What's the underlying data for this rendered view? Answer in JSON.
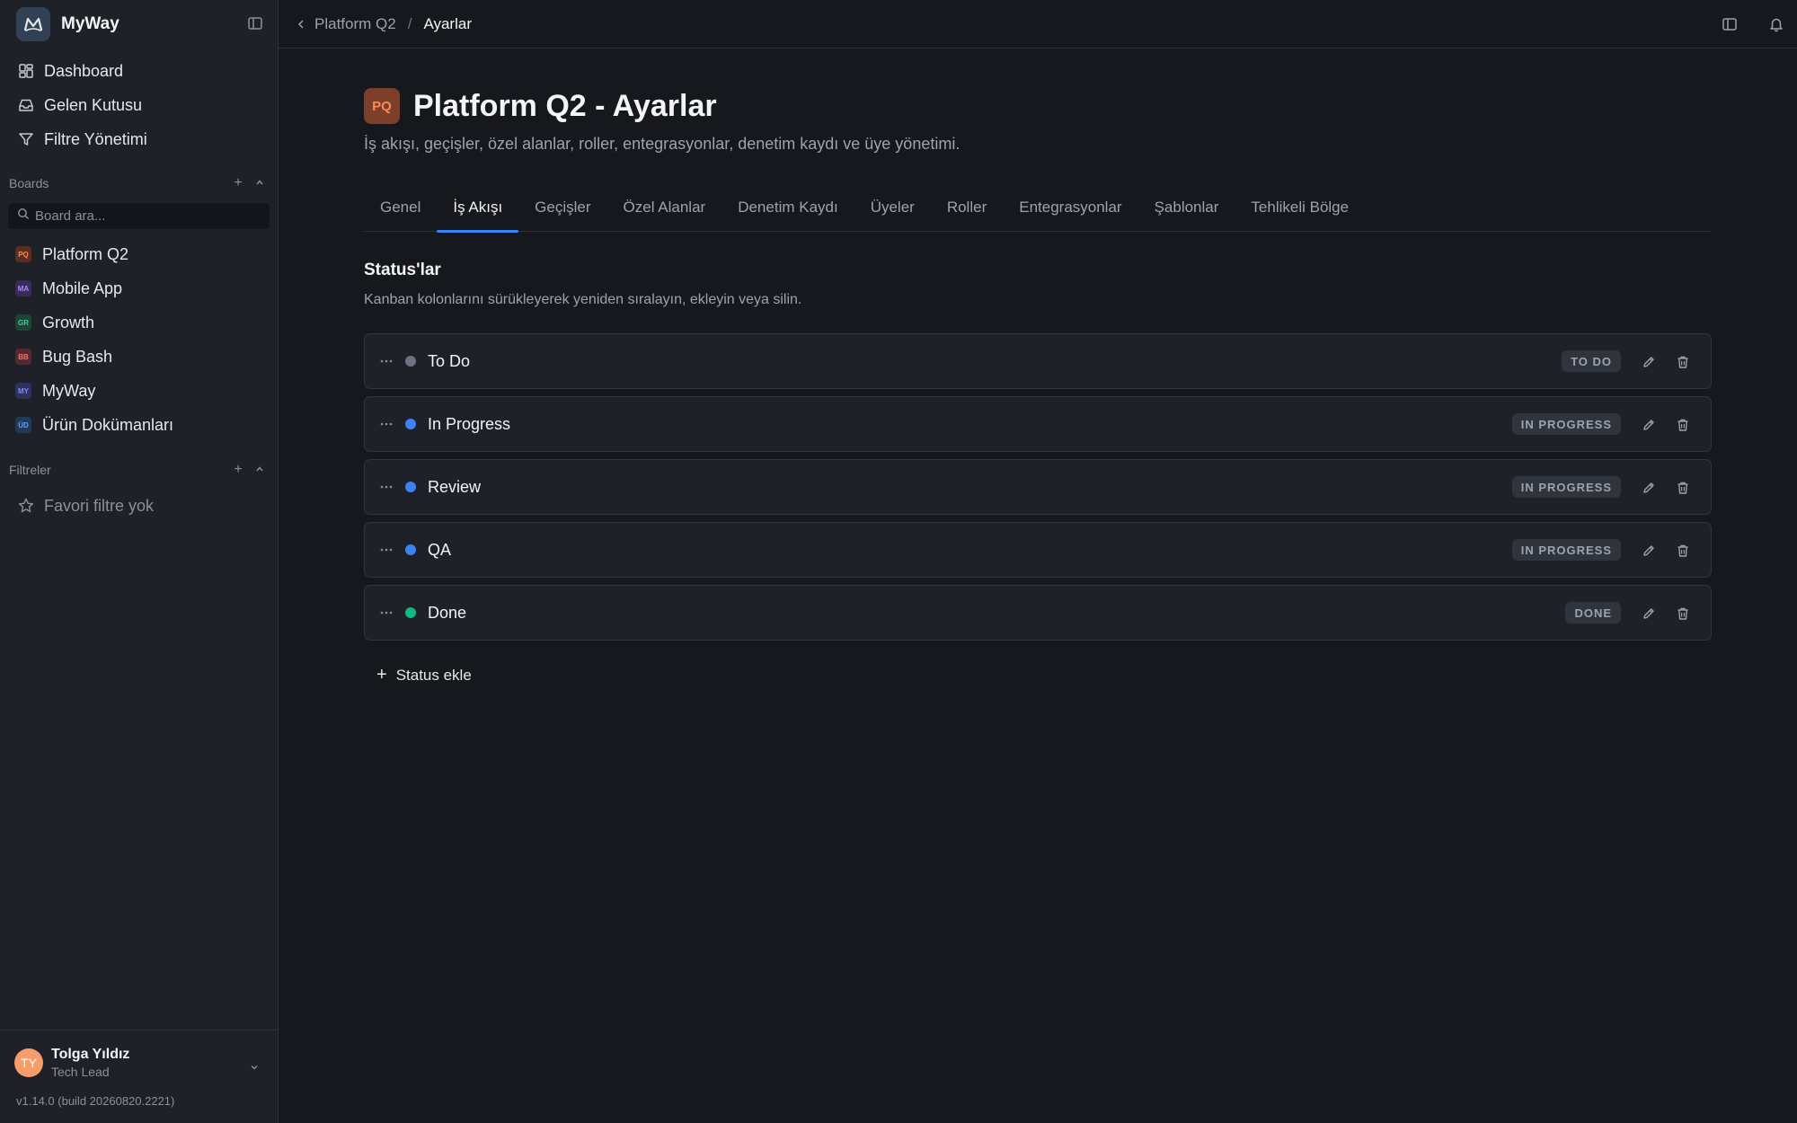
{
  "sidebar": {
    "brand": "MyWay",
    "nav": [
      {
        "label": "Dashboard",
        "icon": "dashboard-icon"
      },
      {
        "label": "Gelen Kutusu",
        "icon": "inbox-icon"
      },
      {
        "label": "Filtre Yönetimi",
        "icon": "filter-icon"
      }
    ],
    "boards_heading": "Boards",
    "board_search_placeholder": "Board ara...",
    "boards": [
      {
        "code": "PQ",
        "label": "Platform Q2",
        "color": "#fb8a56",
        "bg": "#5a2e22"
      },
      {
        "code": "MA",
        "label": "Mobile App",
        "color": "#a78bfa",
        "bg": "#3b2b5c"
      },
      {
        "code": "GR",
        "label": "Growth",
        "color": "#34d399",
        "bg": "#1f4436"
      },
      {
        "code": "BB",
        "label": "Bug Bash",
        "color": "#f87171",
        "bg": "#552a2e"
      },
      {
        "code": "MY",
        "label": "MyWay",
        "color": "#818cf8",
        "bg": "#2e3160"
      },
      {
        "code": "ÜD",
        "label": "Ürün Dokümanları",
        "color": "#60a5fa",
        "bg": "#23395a"
      }
    ],
    "filters_heading": "Filtreler",
    "favorites_empty": "Favori filtre yok",
    "user": {
      "initials": "TY",
      "name": "Tolga Yıldız",
      "role": "Tech Lead"
    },
    "version": "v1.14.0 (build 20260820.2221)"
  },
  "breadcrumb": {
    "parent": "Platform Q2",
    "separator": "/",
    "current": "Ayarlar"
  },
  "page": {
    "badge": "PQ",
    "title": "Platform Q2 - Ayarlar",
    "subtitle": "İş akışı, geçişler, özel alanlar, roller, entegrasyonlar, denetim kaydı ve üye yönetimi."
  },
  "tabs": [
    "Genel",
    "İş Akışı",
    "Geçişler",
    "Özel Alanlar",
    "Denetim Kaydı",
    "Üyeler",
    "Roller",
    "Entegrasyonlar",
    "Şablonlar",
    "Tehlikeli Bölge"
  ],
  "active_tab": "İş Akışı",
  "statuses_section": {
    "title": "Status'lar",
    "description": "Kanban kolonlarını sürükleyerek yeniden sıralayın, ekleyin veya silin.",
    "items": [
      {
        "name": "To Do",
        "category": "TO DO",
        "color": "#6b7280"
      },
      {
        "name": "In Progress",
        "category": "IN PROGRESS",
        "color": "#3b82f6"
      },
      {
        "name": "Review",
        "category": "IN PROGRESS",
        "color": "#3b82f6"
      },
      {
        "name": "QA",
        "category": "IN PROGRESS",
        "color": "#3b82f6"
      },
      {
        "name": "Done",
        "category": "DONE",
        "color": "#10b981"
      }
    ],
    "add_label": "Status ekle"
  }
}
